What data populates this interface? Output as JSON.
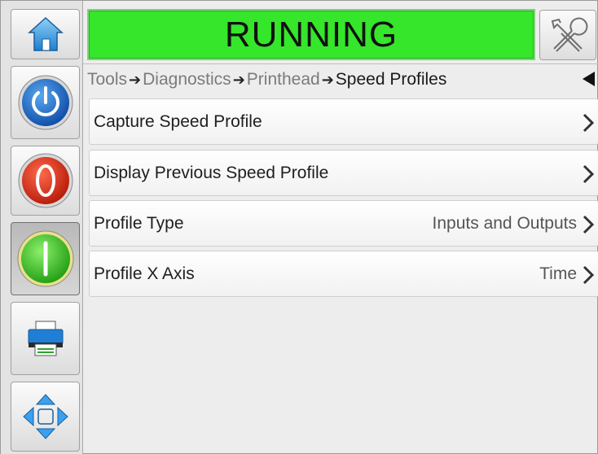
{
  "status": {
    "text": "RUNNING",
    "color": "#35e62a"
  },
  "breadcrumb": {
    "items": [
      "Tools",
      "Diagnostics",
      "Printhead"
    ],
    "current": "Speed Profiles",
    "separator": "➔"
  },
  "rail": {
    "buttons": [
      {
        "name": "home",
        "icon": "home-icon"
      },
      {
        "name": "power",
        "icon": "power-icon"
      },
      {
        "name": "stop",
        "icon": "stop-icon"
      },
      {
        "name": "start",
        "icon": "start-icon",
        "pressed": true
      },
      {
        "name": "print",
        "icon": "printer-icon"
      },
      {
        "name": "navigate",
        "icon": "navigation-arrows-icon"
      }
    ]
  },
  "menu": [
    {
      "label": "Capture Speed Profile",
      "value": ""
    },
    {
      "label": "Display Previous Speed Profile",
      "value": ""
    },
    {
      "label": "Profile Type",
      "value": "Inputs and Outputs"
    },
    {
      "label": "Profile X Axis",
      "value": "Time"
    }
  ]
}
